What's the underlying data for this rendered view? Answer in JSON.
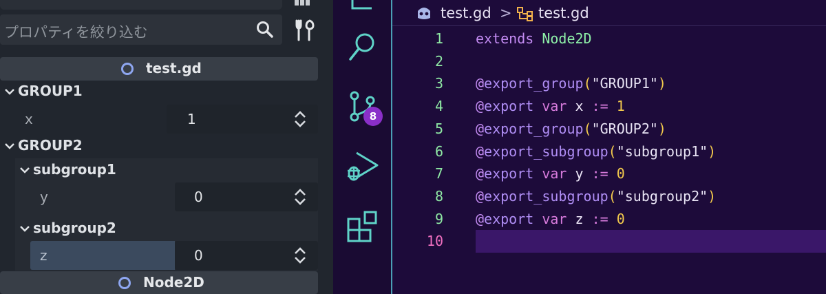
{
  "inspector": {
    "filter_placeholder": "プロパティを絞り込む",
    "sections": [
      {
        "title": "test.gd"
      },
      {
        "title": "Node2D"
      }
    ],
    "groups": [
      {
        "label": "GROUP1"
      },
      {
        "label": "GROUP2"
      }
    ],
    "subgroups": [
      {
        "label": "subgroup1"
      },
      {
        "label": "subgroup2"
      }
    ],
    "properties": [
      {
        "name": "x",
        "value": "1"
      },
      {
        "name": "y",
        "value": "0"
      },
      {
        "name": "z",
        "value": "0"
      }
    ],
    "colors": {
      "background": "#21262e",
      "section_ring": "#8ea6f0",
      "selected_property": "#3b4a5e"
    }
  },
  "activity_bar": {
    "items": [
      {
        "icon": "search-icon"
      },
      {
        "icon": "source-control-icon",
        "badge": "8"
      },
      {
        "icon": "run-debug-icon"
      },
      {
        "icon": "extensions-icon"
      }
    ],
    "badge_color": "#8a2fc9"
  },
  "editor": {
    "breadcrumb": {
      "file": "test.gd",
      "separator": ">",
      "symbol": "test.gd"
    },
    "current_line": "10",
    "lines": [
      {
        "n": "1",
        "tokens": [
          "extends",
          " ",
          "Node2D"
        ]
      },
      {
        "n": "2",
        "tokens": []
      },
      {
        "n": "3",
        "tokens": [
          "@",
          "export_group",
          "(",
          "\"GROUP1\"",
          ")"
        ]
      },
      {
        "n": "4",
        "tokens": [
          "@",
          "export",
          " ",
          "var",
          " ",
          "x",
          " ",
          ":=",
          " ",
          "1"
        ]
      },
      {
        "n": "5",
        "tokens": [
          "@",
          "export_group",
          "(",
          "\"GROUP2\"",
          ")"
        ]
      },
      {
        "n": "6",
        "tokens": [
          "@",
          "export_subgroup",
          "(",
          "\"subgroup1\"",
          ")"
        ]
      },
      {
        "n": "7",
        "tokens": [
          "@",
          "export",
          " ",
          "var",
          " ",
          "y",
          " ",
          ":=",
          " ",
          "0"
        ]
      },
      {
        "n": "8",
        "tokens": [
          "@",
          "export_subgroup",
          "(",
          "\"subgroup2\"",
          ")"
        ]
      },
      {
        "n": "9",
        "tokens": [
          "@",
          "export",
          " ",
          "var",
          " ",
          "z",
          " ",
          ":=",
          " ",
          "0"
        ]
      },
      {
        "n": "10",
        "tokens": []
      }
    ],
    "colors": {
      "background": "#1d0b3a",
      "line_highlight": "#3a1769",
      "line_number": "#8fe8a4"
    }
  }
}
